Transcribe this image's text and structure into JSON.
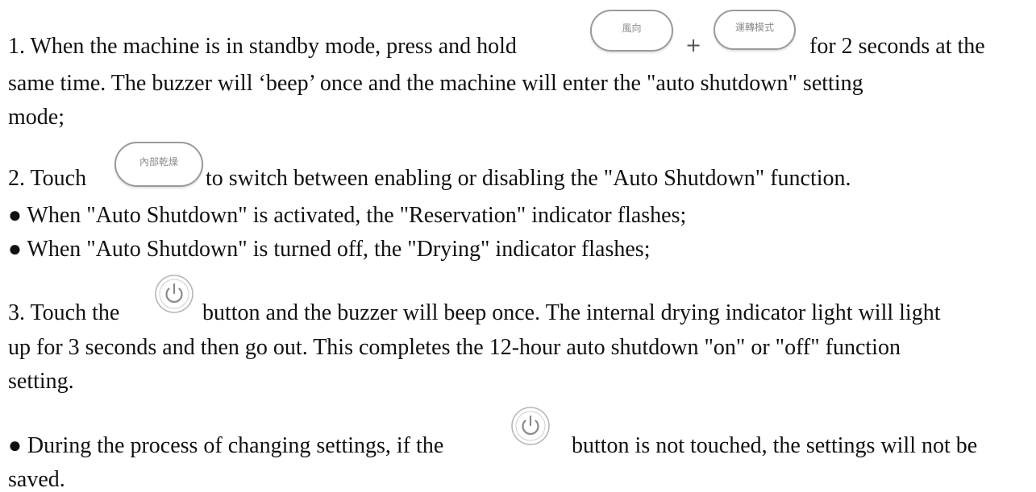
{
  "steps": {
    "s1_before": "1. When the machine is in standby mode, press and hold",
    "s1_plus": "+",
    "s1_after": "for 2 seconds at the",
    "s1_line2": "same time. The buzzer will ‘beep’ once and the machine will enter the \"auto shutdown\" setting",
    "s1_line3": "mode;",
    "s2_before": "2. Touch",
    "s2_after": "to switch between enabling or disabling the \"Auto Shutdown\" function.",
    "s2_bullet1": "● When \"Auto Shutdown\" is activated, the \"Reservation\" indicator flashes;",
    "s2_bullet2": "● When \"Auto Shutdown\" is turned off, the \"Drying\" indicator flashes;",
    "s3_before": "3. Touch the",
    "s3_after": "button and the buzzer will beep once. The internal drying indicator light will light",
    "s3_line2": "up for 3 seconds and then go out. This completes the 12-hour auto shutdown \"on\" or \"off\" function",
    "s3_line3": "setting.",
    "note_before": "● During the process of changing settings, if the",
    "note_after": "button is not touched, the settings will not be",
    "note_line2": "saved."
  },
  "buttons": {
    "wind_direction": "風向",
    "operation_mode": "運轉模式",
    "internal_drying": "內部乾燥"
  },
  "icons": {
    "power": "power-icon"
  }
}
